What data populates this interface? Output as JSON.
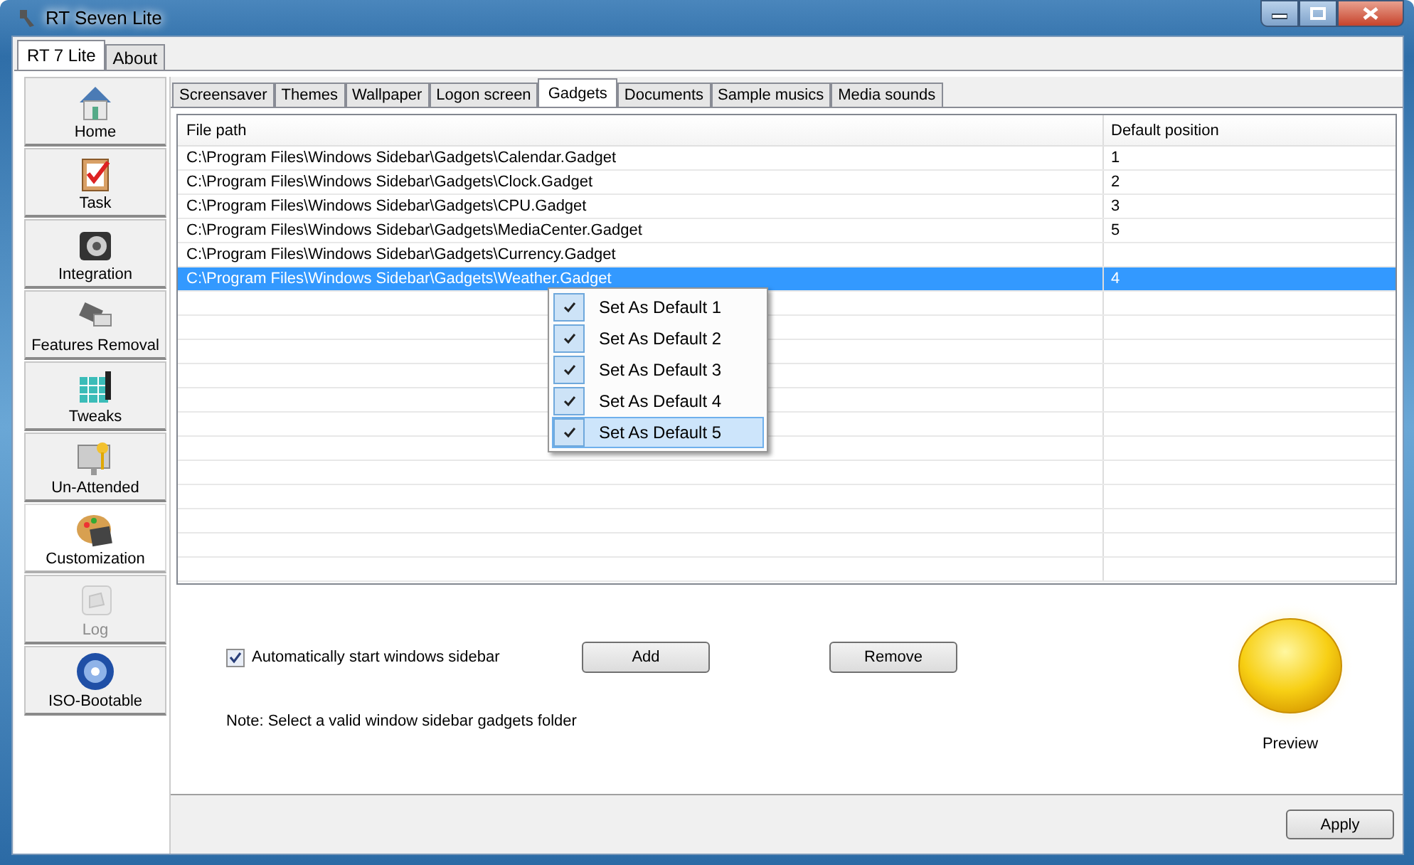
{
  "window": {
    "title": "RT Seven Lite"
  },
  "top_tabs": [
    {
      "label": "RT 7 Lite",
      "selected": true
    },
    {
      "label": "About",
      "selected": false
    }
  ],
  "sidebar": {
    "items": [
      {
        "label": "Home",
        "selected": false,
        "disabled": false
      },
      {
        "label": "Task",
        "selected": false,
        "disabled": false
      },
      {
        "label": "Integration",
        "selected": false,
        "disabled": false
      },
      {
        "label": "Features Removal",
        "selected": false,
        "disabled": false
      },
      {
        "label": "Tweaks",
        "selected": false,
        "disabled": false
      },
      {
        "label": "Un-Attended",
        "selected": false,
        "disabled": false
      },
      {
        "label": "Customization",
        "selected": true,
        "disabled": false
      },
      {
        "label": "Log",
        "selected": false,
        "disabled": true
      },
      {
        "label": "ISO-Bootable",
        "selected": false,
        "disabled": false
      }
    ]
  },
  "sub_tabs": [
    {
      "label": "Screensaver",
      "selected": false
    },
    {
      "label": "Themes",
      "selected": false
    },
    {
      "label": "Wallpaper",
      "selected": false
    },
    {
      "label": "Logon screen",
      "selected": false
    },
    {
      "label": "Gadgets",
      "selected": true
    },
    {
      "label": "Documents",
      "selected": false
    },
    {
      "label": "Sample musics",
      "selected": false
    },
    {
      "label": "Media sounds",
      "selected": false
    }
  ],
  "table": {
    "columns": [
      "File path",
      "Default position"
    ],
    "rows": [
      {
        "cells": [
          "C:\\Program Files\\Windows Sidebar\\Gadgets\\Calendar.Gadget",
          "1"
        ],
        "selected": false
      },
      {
        "cells": [
          "C:\\Program Files\\Windows Sidebar\\Gadgets\\Clock.Gadget",
          "2"
        ],
        "selected": false
      },
      {
        "cells": [
          "C:\\Program Files\\Windows Sidebar\\Gadgets\\CPU.Gadget",
          "3"
        ],
        "selected": false
      },
      {
        "cells": [
          "C:\\Program Files\\Windows Sidebar\\Gadgets\\MediaCenter.Gadget",
          "5"
        ],
        "selected": false
      },
      {
        "cells": [
          "C:\\Program Files\\Windows Sidebar\\Gadgets\\Currency.Gadget",
          ""
        ],
        "selected": false
      },
      {
        "cells": [
          "C:\\Program Files\\Windows Sidebar\\Gadgets\\Weather.Gadget",
          "4"
        ],
        "selected": true
      }
    ]
  },
  "context_menu": {
    "items": [
      {
        "label": "Set As Default 1",
        "checked": true,
        "selected": false
      },
      {
        "label": "Set As Default 2",
        "checked": true,
        "selected": false
      },
      {
        "label": "Set As Default 3",
        "checked": true,
        "selected": false
      },
      {
        "label": "Set As Default 4",
        "checked": true,
        "selected": false
      },
      {
        "label": "Set As Default 5",
        "checked": true,
        "selected": true
      }
    ]
  },
  "options": {
    "autostart": {
      "label": "Automatically start windows sidebar",
      "checked": true
    },
    "add_button": "Add",
    "remove_button": "Remove",
    "note": "Note: Select a valid window sidebar gadgets folder",
    "preview_label": "Preview"
  },
  "apply_button": "Apply"
}
